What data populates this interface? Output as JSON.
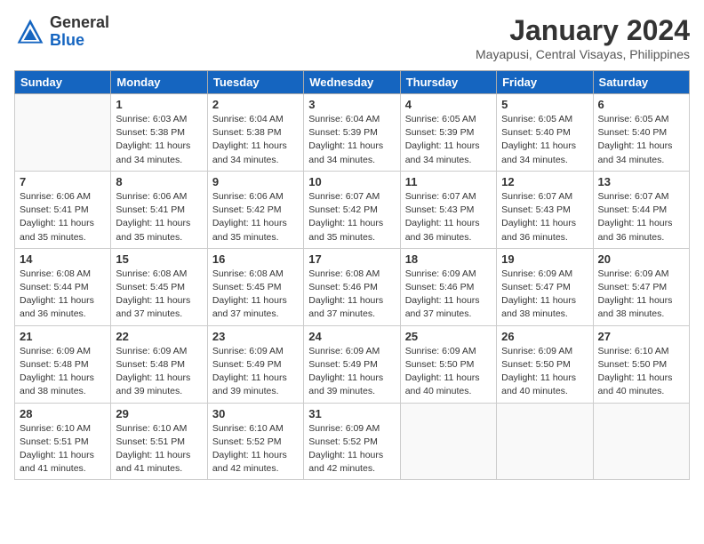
{
  "header": {
    "logo": {
      "general": "General",
      "blue": "Blue"
    },
    "title": "January 2024",
    "location": "Mayapusi, Central Visayas, Philippines"
  },
  "days_header": [
    "Sunday",
    "Monday",
    "Tuesday",
    "Wednesday",
    "Thursday",
    "Friday",
    "Saturday"
  ],
  "weeks": [
    [
      {
        "day": "",
        "sunrise": "",
        "sunset": "",
        "daylight": ""
      },
      {
        "day": "1",
        "sunrise": "Sunrise: 6:03 AM",
        "sunset": "Sunset: 5:38 PM",
        "daylight": "Daylight: 11 hours and 34 minutes."
      },
      {
        "day": "2",
        "sunrise": "Sunrise: 6:04 AM",
        "sunset": "Sunset: 5:38 PM",
        "daylight": "Daylight: 11 hours and 34 minutes."
      },
      {
        "day": "3",
        "sunrise": "Sunrise: 6:04 AM",
        "sunset": "Sunset: 5:39 PM",
        "daylight": "Daylight: 11 hours and 34 minutes."
      },
      {
        "day": "4",
        "sunrise": "Sunrise: 6:05 AM",
        "sunset": "Sunset: 5:39 PM",
        "daylight": "Daylight: 11 hours and 34 minutes."
      },
      {
        "day": "5",
        "sunrise": "Sunrise: 6:05 AM",
        "sunset": "Sunset: 5:40 PM",
        "daylight": "Daylight: 11 hours and 34 minutes."
      },
      {
        "day": "6",
        "sunrise": "Sunrise: 6:05 AM",
        "sunset": "Sunset: 5:40 PM",
        "daylight": "Daylight: 11 hours and 34 minutes."
      }
    ],
    [
      {
        "day": "7",
        "sunrise": "Sunrise: 6:06 AM",
        "sunset": "Sunset: 5:41 PM",
        "daylight": "Daylight: 11 hours and 35 minutes."
      },
      {
        "day": "8",
        "sunrise": "Sunrise: 6:06 AM",
        "sunset": "Sunset: 5:41 PM",
        "daylight": "Daylight: 11 hours and 35 minutes."
      },
      {
        "day": "9",
        "sunrise": "Sunrise: 6:06 AM",
        "sunset": "Sunset: 5:42 PM",
        "daylight": "Daylight: 11 hours and 35 minutes."
      },
      {
        "day": "10",
        "sunrise": "Sunrise: 6:07 AM",
        "sunset": "Sunset: 5:42 PM",
        "daylight": "Daylight: 11 hours and 35 minutes."
      },
      {
        "day": "11",
        "sunrise": "Sunrise: 6:07 AM",
        "sunset": "Sunset: 5:43 PM",
        "daylight": "Daylight: 11 hours and 36 minutes."
      },
      {
        "day": "12",
        "sunrise": "Sunrise: 6:07 AM",
        "sunset": "Sunset: 5:43 PM",
        "daylight": "Daylight: 11 hours and 36 minutes."
      },
      {
        "day": "13",
        "sunrise": "Sunrise: 6:07 AM",
        "sunset": "Sunset: 5:44 PM",
        "daylight": "Daylight: 11 hours and 36 minutes."
      }
    ],
    [
      {
        "day": "14",
        "sunrise": "Sunrise: 6:08 AM",
        "sunset": "Sunset: 5:44 PM",
        "daylight": "Daylight: 11 hours and 36 minutes."
      },
      {
        "day": "15",
        "sunrise": "Sunrise: 6:08 AM",
        "sunset": "Sunset: 5:45 PM",
        "daylight": "Daylight: 11 hours and 37 minutes."
      },
      {
        "day": "16",
        "sunrise": "Sunrise: 6:08 AM",
        "sunset": "Sunset: 5:45 PM",
        "daylight": "Daylight: 11 hours and 37 minutes."
      },
      {
        "day": "17",
        "sunrise": "Sunrise: 6:08 AM",
        "sunset": "Sunset: 5:46 PM",
        "daylight": "Daylight: 11 hours and 37 minutes."
      },
      {
        "day": "18",
        "sunrise": "Sunrise: 6:09 AM",
        "sunset": "Sunset: 5:46 PM",
        "daylight": "Daylight: 11 hours and 37 minutes."
      },
      {
        "day": "19",
        "sunrise": "Sunrise: 6:09 AM",
        "sunset": "Sunset: 5:47 PM",
        "daylight": "Daylight: 11 hours and 38 minutes."
      },
      {
        "day": "20",
        "sunrise": "Sunrise: 6:09 AM",
        "sunset": "Sunset: 5:47 PM",
        "daylight": "Daylight: 11 hours and 38 minutes."
      }
    ],
    [
      {
        "day": "21",
        "sunrise": "Sunrise: 6:09 AM",
        "sunset": "Sunset: 5:48 PM",
        "daylight": "Daylight: 11 hours and 38 minutes."
      },
      {
        "day": "22",
        "sunrise": "Sunrise: 6:09 AM",
        "sunset": "Sunset: 5:48 PM",
        "daylight": "Daylight: 11 hours and 39 minutes."
      },
      {
        "day": "23",
        "sunrise": "Sunrise: 6:09 AM",
        "sunset": "Sunset: 5:49 PM",
        "daylight": "Daylight: 11 hours and 39 minutes."
      },
      {
        "day": "24",
        "sunrise": "Sunrise: 6:09 AM",
        "sunset": "Sunset: 5:49 PM",
        "daylight": "Daylight: 11 hours and 39 minutes."
      },
      {
        "day": "25",
        "sunrise": "Sunrise: 6:09 AM",
        "sunset": "Sunset: 5:50 PM",
        "daylight": "Daylight: 11 hours and 40 minutes."
      },
      {
        "day": "26",
        "sunrise": "Sunrise: 6:09 AM",
        "sunset": "Sunset: 5:50 PM",
        "daylight": "Daylight: 11 hours and 40 minutes."
      },
      {
        "day": "27",
        "sunrise": "Sunrise: 6:10 AM",
        "sunset": "Sunset: 5:50 PM",
        "daylight": "Daylight: 11 hours and 40 minutes."
      }
    ],
    [
      {
        "day": "28",
        "sunrise": "Sunrise: 6:10 AM",
        "sunset": "Sunset: 5:51 PM",
        "daylight": "Daylight: 11 hours and 41 minutes."
      },
      {
        "day": "29",
        "sunrise": "Sunrise: 6:10 AM",
        "sunset": "Sunset: 5:51 PM",
        "daylight": "Daylight: 11 hours and 41 minutes."
      },
      {
        "day": "30",
        "sunrise": "Sunrise: 6:10 AM",
        "sunset": "Sunset: 5:52 PM",
        "daylight": "Daylight: 11 hours and 42 minutes."
      },
      {
        "day": "31",
        "sunrise": "Sunrise: 6:09 AM",
        "sunset": "Sunset: 5:52 PM",
        "daylight": "Daylight: 11 hours and 42 minutes."
      },
      {
        "day": "",
        "sunrise": "",
        "sunset": "",
        "daylight": ""
      },
      {
        "day": "",
        "sunrise": "",
        "sunset": "",
        "daylight": ""
      },
      {
        "day": "",
        "sunrise": "",
        "sunset": "",
        "daylight": ""
      }
    ]
  ]
}
